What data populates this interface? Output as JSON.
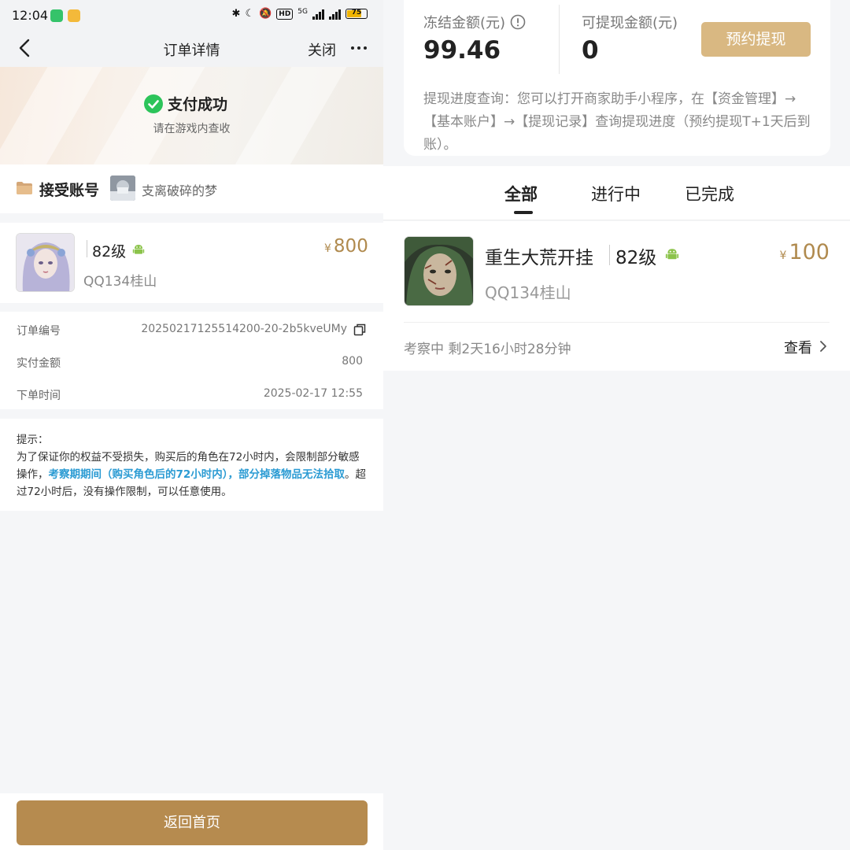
{
  "left": {
    "status_bar": {
      "time": "12:04",
      "network": "5G",
      "battery": "75"
    },
    "nav": {
      "title": "订单详情",
      "close": "关闭"
    },
    "hero": {
      "title": "支付成功",
      "subtitle": "请在游戏内查收"
    },
    "account": {
      "label": "接受账号",
      "name": "支离破碎的梦"
    },
    "product": {
      "level": "82级",
      "server": "QQ134桂山",
      "currency": "¥",
      "price": "800"
    },
    "details": [
      {
        "label": "订单编号",
        "value": "20250217125514200-20-2b5kveUMy"
      },
      {
        "label": "实付金额",
        "value": "800"
      },
      {
        "label": "下单时间",
        "value": "2025-02-17 12:55"
      }
    ],
    "tip": {
      "title": "提示：",
      "text1": "为了保证你的权益不受损失，购买后的角色在72小时内，会限制部分敏感操作，",
      "highlight": "考察期期间（购买角色后的72小时内），部分掉落物品无法拾取",
      "text2": "。超过72小时后，没有操作限制，可以任意使用。"
    },
    "bottom_button": "返回首页"
  },
  "right": {
    "balance": {
      "frozen_label": "冻结金额(元)",
      "frozen_value": "99.46",
      "withdrawable_label": "可提现金额(元)",
      "withdrawable_value": "0",
      "withdraw_button": "预约提现",
      "note": "提现进度查询：您可以打开商家助手小程序，在【资金管理】→【基本账户】→【提现记录】查询提现进度（预约提现T+1天后到账）。"
    },
    "tabs": [
      "全部",
      "进行中",
      "已完成"
    ],
    "active_tab": "全部",
    "order": {
      "title": "重生大荒开挂",
      "level": "82级",
      "server": "QQ134桂山",
      "currency": "¥",
      "price": "100",
      "status": "考察中 剩2天16小时28分钟",
      "view": "查看"
    }
  },
  "colors": {
    "gold": "#b68b4f",
    "gold_light": "#d9b882",
    "price": "#b08a4e",
    "link": "#2b9bd3",
    "success": "#2cc45a"
  }
}
